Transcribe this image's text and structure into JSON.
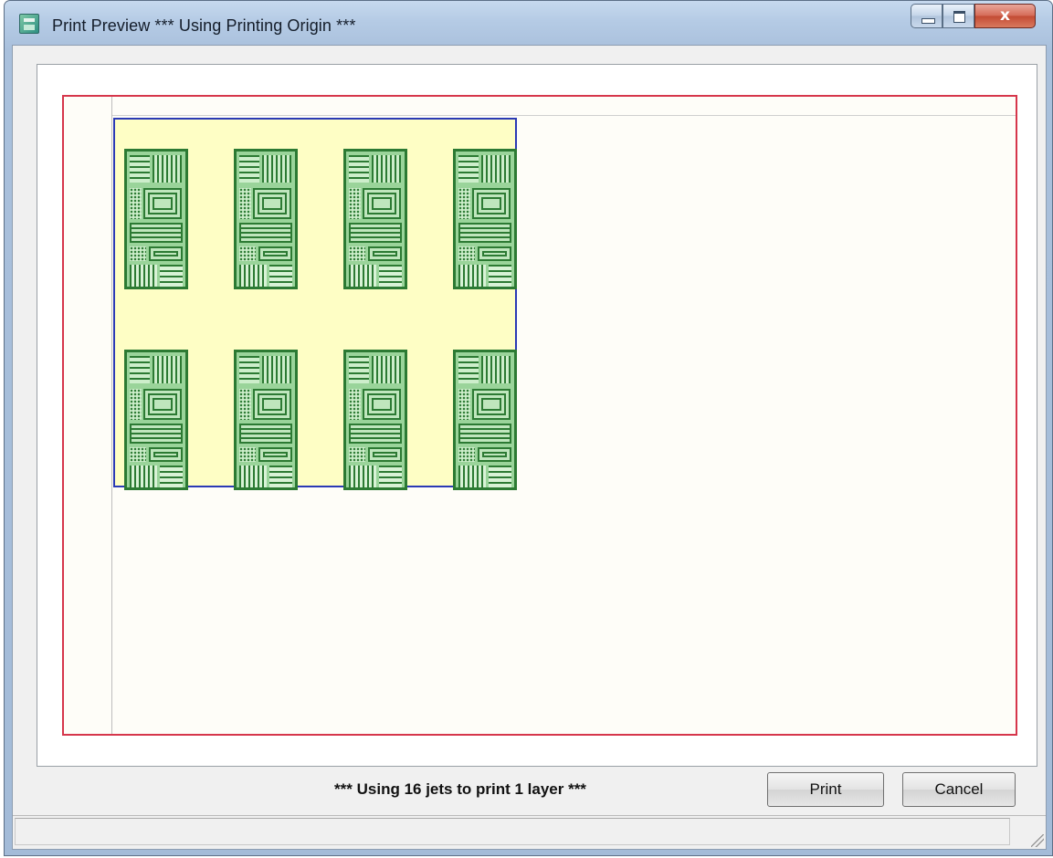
{
  "window": {
    "title": "Print Preview  *** Using Printing Origin ***",
    "icon": "app-icon"
  },
  "caption_buttons": {
    "minimize_icon": "minimize-icon",
    "maximize_icon": "maximize-icon",
    "close_glyph": "x"
  },
  "preview": {
    "page_border_color": "#d6364b",
    "print_origin_border_color": "#2b3ab5",
    "print_origin_fill": "#fefec5",
    "board_color": "#2c7a33",
    "board_grid": {
      "columns": 4,
      "rows": 2
    }
  },
  "footer": {
    "status_message": "*** Using 16 jets to print 1 layer ***",
    "print_label": "Print",
    "cancel_label": "Cancel"
  }
}
